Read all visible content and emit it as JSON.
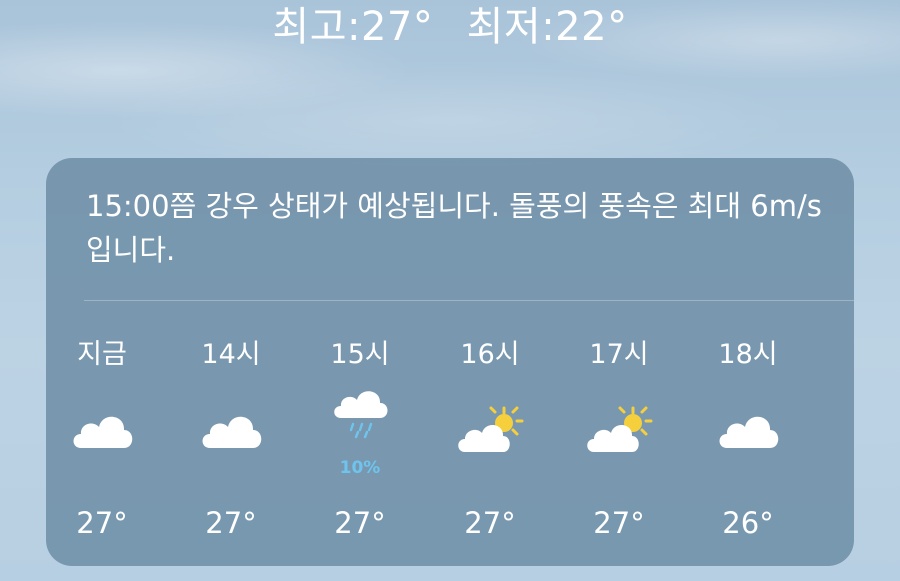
{
  "header": {
    "high": "최고:27°",
    "low": "최저:22°"
  },
  "forecast_card": {
    "summary": "15:00쯤 강우 상태가 예상됩니다. 돌풍의 풍속은 최대 6m/s입니다.",
    "hours": [
      {
        "label": "지금",
        "icon": "cloud-icon",
        "temp": "27°",
        "precip": ""
      },
      {
        "label": "14시",
        "icon": "cloud-icon",
        "temp": "27°",
        "precip": ""
      },
      {
        "label": "15시",
        "icon": "cloud-rain-icon",
        "temp": "27°",
        "precip": "10%"
      },
      {
        "label": "16시",
        "icon": "partly-sunny-icon",
        "temp": "27°",
        "precip": ""
      },
      {
        "label": "17시",
        "icon": "partly-sunny-icon",
        "temp": "27°",
        "precip": ""
      },
      {
        "label": "18시",
        "icon": "cloud-icon",
        "temp": "26°",
        "precip": ""
      }
    ]
  },
  "colors": {
    "precip": "#6fc4ee",
    "sun": "#f6cf3c",
    "cloud": "#ffffff"
  }
}
